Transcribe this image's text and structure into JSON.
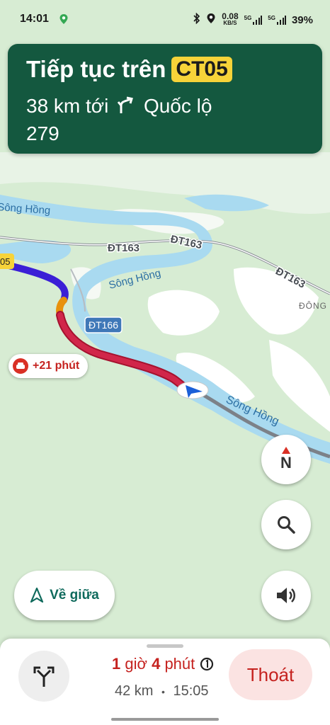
{
  "status_bar": {
    "time": "14:01",
    "data_speed_value": "0.08",
    "data_speed_unit": "KB/S",
    "network_1": "5G",
    "network_2": "5G",
    "battery": "39%"
  },
  "banner": {
    "instruction": "Tiếp tục trên",
    "road_badge": "CT05",
    "distance_text": "38 km tới",
    "next_road_line1": "Quốc lộ",
    "next_road_line2": "279"
  },
  "map_labels": {
    "river_1": "Sông Hồng",
    "river_2": "Sông Hồng",
    "river_3": "Sông Hồng",
    "road_dt163_a": "ĐT163",
    "road_dt163_b": "ĐT163",
    "road_dt163_c": "ĐT163",
    "road_dt166": "ĐT166",
    "road_edge_badge": "05",
    "place_dong": "ĐÔNG"
  },
  "delay_chip": {
    "text": "+21 phút"
  },
  "controls": {
    "compass_label": "N",
    "center_button_label": "Về giữa"
  },
  "bottom_sheet": {
    "eta_hours_value": "1",
    "eta_hours_unit": "giờ",
    "eta_minutes_value": "4",
    "eta_minutes_unit": "phút",
    "distance": "42 km",
    "separator": "•",
    "arrival_time": "15:05",
    "exit_label": "Thoát"
  },
  "colors": {
    "banner_bg": "#14583f",
    "route_blue": "#3b1fd6",
    "traffic_red": "#c2183c",
    "river": "#a9daf0",
    "exit_text": "#c5221f"
  }
}
